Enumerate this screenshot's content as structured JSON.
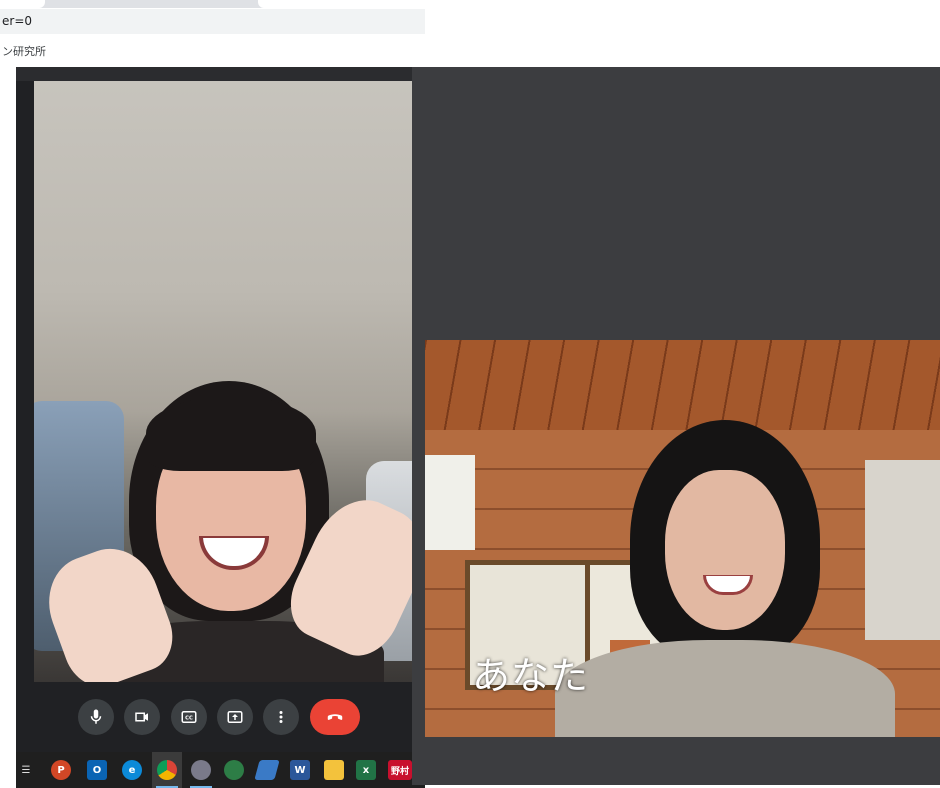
{
  "browser": {
    "address_text": "er=0",
    "page_subtitle": "ン研究所"
  },
  "meet": {
    "controls": [
      {
        "name": "microphone",
        "icon": "mic-icon"
      },
      {
        "name": "camera",
        "icon": "video-camera-icon"
      },
      {
        "name": "captions",
        "icon": "closed-captions-icon",
        "label": "CC"
      },
      {
        "name": "present",
        "icon": "present-screen-icon"
      },
      {
        "name": "more-options",
        "icon": "more-vert-icon"
      },
      {
        "name": "hang-up",
        "icon": "phone-hangup-icon"
      }
    ],
    "self_view_label": "あなた",
    "colors": {
      "background": "#202124",
      "button": "#3c4043",
      "hangup": "#ea4335",
      "stage": "#3c3d40"
    }
  },
  "taskbar": {
    "icons": [
      {
        "name": "task-view",
        "label": "☰"
      },
      {
        "name": "powerpoint",
        "label": "P",
        "color": "#d24726"
      },
      {
        "name": "outlook",
        "label": "O",
        "color": "#0a64b4"
      },
      {
        "name": "edge",
        "label": "e",
        "color": "#0c8ad8"
      },
      {
        "name": "chrome",
        "label": "",
        "color": "#db4437"
      },
      {
        "name": "paint",
        "label": "",
        "color": "#7a7a8a"
      },
      {
        "name": "installer",
        "label": "",
        "color": "#2d7d46"
      },
      {
        "name": "app",
        "label": "",
        "color": "#3a7ac6"
      },
      {
        "name": "word",
        "label": "W",
        "color": "#2b579a"
      },
      {
        "name": "explorer",
        "label": "",
        "color": "#f3c23c"
      },
      {
        "name": "excel",
        "label": "x",
        "color": "#217346"
      },
      {
        "name": "nomura",
        "label": "野村",
        "color": "#c8102e"
      }
    ]
  }
}
